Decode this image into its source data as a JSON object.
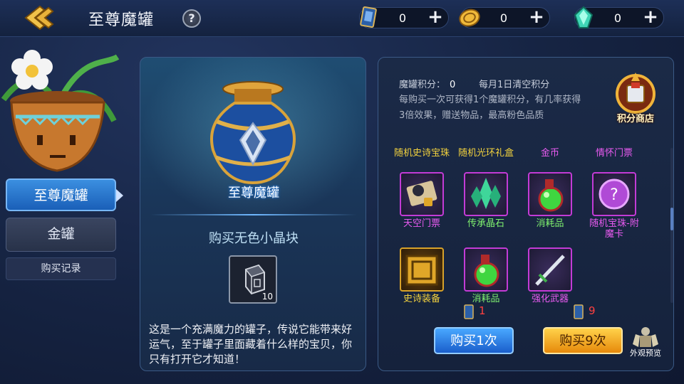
{
  "header": {
    "title": "至尊魔罐",
    "help": "?",
    "currencies": [
      {
        "icon": "card-icon",
        "value": "0",
        "plus": "+"
      },
      {
        "icon": "coin-icon",
        "value": "0",
        "plus": "+"
      },
      {
        "icon": "gem-icon",
        "value": "0",
        "plus": "+"
      }
    ]
  },
  "sidebar": {
    "tabs": [
      {
        "label": "至尊魔罐",
        "active": true
      },
      {
        "label": "金罐",
        "active": false
      }
    ],
    "record": "购买记录"
  },
  "jar_panel": {
    "name": "至尊魔罐",
    "buy_title": "购买无色小晶块",
    "cost_item_count": "10",
    "description": "这是一个充满魔力的罐子，传说它能带来好运气，至于罐子里面藏着什么样的宝贝，你只有打开它才知道！"
  },
  "reward_panel": {
    "score_label": "魔罐积分：",
    "score_value": "0",
    "reset_note": "每月1日清空积分",
    "rule": "每购买一次可获得1个魔罐积分，有几率获得3倍效果，赠送物品，最高粉色品质",
    "shop_label": "积分商店",
    "top_row_labels": [
      "随机史诗宝珠",
      "随机光环礼盒",
      "金币",
      "情怀门票"
    ],
    "items": [
      {
        "name": "天空门票",
        "icon": "ticket-icon",
        "color": "pink"
      },
      {
        "name": "传承晶石",
        "icon": "crystal-icon",
        "color": "green"
      },
      {
        "name": "消耗品",
        "icon": "potion-icon",
        "color": "green"
      },
      {
        "name": "随机宝珠-附魔卡",
        "icon": "orb-icon",
        "color": "pink"
      },
      {
        "name": "史诗装备",
        "icon": "chest-icon",
        "color": "yellow"
      },
      {
        "name": "消耗品",
        "icon": "potion-icon",
        "color": "green"
      },
      {
        "name": "强化武器",
        "icon": "sword-icon",
        "color": "pink"
      }
    ],
    "buy_once": {
      "label": "购买1次",
      "cost": "1"
    },
    "buy_nine": {
      "label": "购买9次",
      "cost": "9"
    },
    "preview": "外观预览"
  },
  "colors": {
    "accent_blue": "#1a5ecb",
    "accent_orange": "#e6890b",
    "pink_rarity": "#e85bf0",
    "cost_red": "#ff4040"
  }
}
